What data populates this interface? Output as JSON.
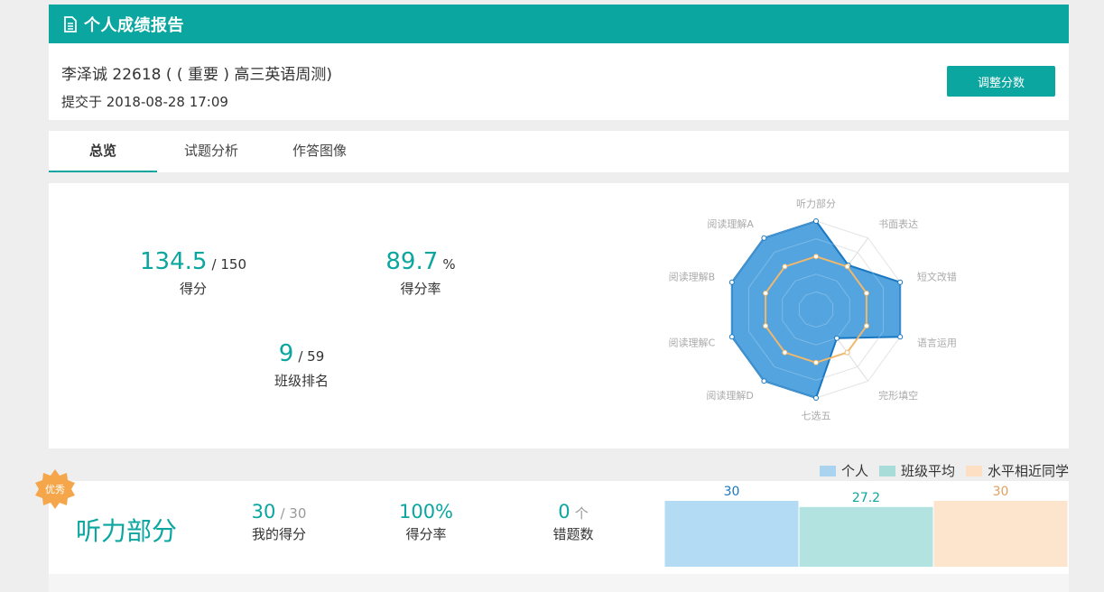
{
  "header": {
    "title": "个人成绩报告",
    "icon": "document-icon"
  },
  "info": {
    "name_line": "李泽诚 22618 ( ( 重要 ) 高三英语周测)",
    "submit_line": "提交于 2018-08-28 17:09",
    "adjust_button": "调整分数"
  },
  "tabs": [
    {
      "label": "总览",
      "active": true
    },
    {
      "label": "试题分析",
      "active": false
    },
    {
      "label": "作答图像",
      "active": false
    }
  ],
  "overview": {
    "score": {
      "value": "134.5",
      "total": "/ 150",
      "label": "得分"
    },
    "rate": {
      "value": "89.7",
      "unit": "%",
      "label": "得分率"
    },
    "rank": {
      "value": "9",
      "total": "/ 59",
      "label": "班级排名"
    }
  },
  "radar": {
    "axes": [
      "听力部分",
      "书面表达",
      "短文改错",
      "语言运用",
      "完形填空",
      "七选五",
      "阅读理解D",
      "阅读理解C",
      "阅读理解B",
      "阅读理解A"
    ],
    "personal": [
      1.0,
      0.62,
      1.0,
      1.0,
      0.4,
      1.0,
      1.0,
      1.0,
      1.0,
      1.0
    ],
    "comparison": [
      0.6,
      0.6,
      0.6,
      0.6,
      0.6,
      0.6,
      0.6,
      0.6,
      0.6,
      0.6
    ],
    "colors": {
      "personal_fill": "#4a9fdd",
      "personal_stroke": "#1a78c2",
      "comparison_stroke": "#f0b86e"
    }
  },
  "legend": [
    {
      "label": "个人",
      "color": "#a9d3ee"
    },
    {
      "label": "班级平均",
      "color": "#a8dcd9"
    },
    {
      "label": "水平相近同学",
      "color": "#fde0c4"
    }
  ],
  "section": {
    "badge": "优秀",
    "title": "听力部分",
    "my_score": {
      "value": "30",
      "total": "/ 30",
      "label": "我的得分"
    },
    "rate": {
      "value": "100%",
      "label": "得分率"
    },
    "wrong": {
      "value": "0",
      "unit": "个",
      "label": "错题数"
    }
  },
  "chart_data": {
    "type": "bar",
    "categories": [
      "个人",
      "班级平均",
      "水平相近同学"
    ],
    "values": [
      30,
      27.2,
      30
    ],
    "ylim": [
      0,
      30
    ],
    "colors": [
      "#b3dbf3",
      "#b3e3e0",
      "#fde5cd"
    ],
    "label_colors": [
      "#1a78c2",
      "#0aa69f",
      "#e0a060"
    ]
  }
}
